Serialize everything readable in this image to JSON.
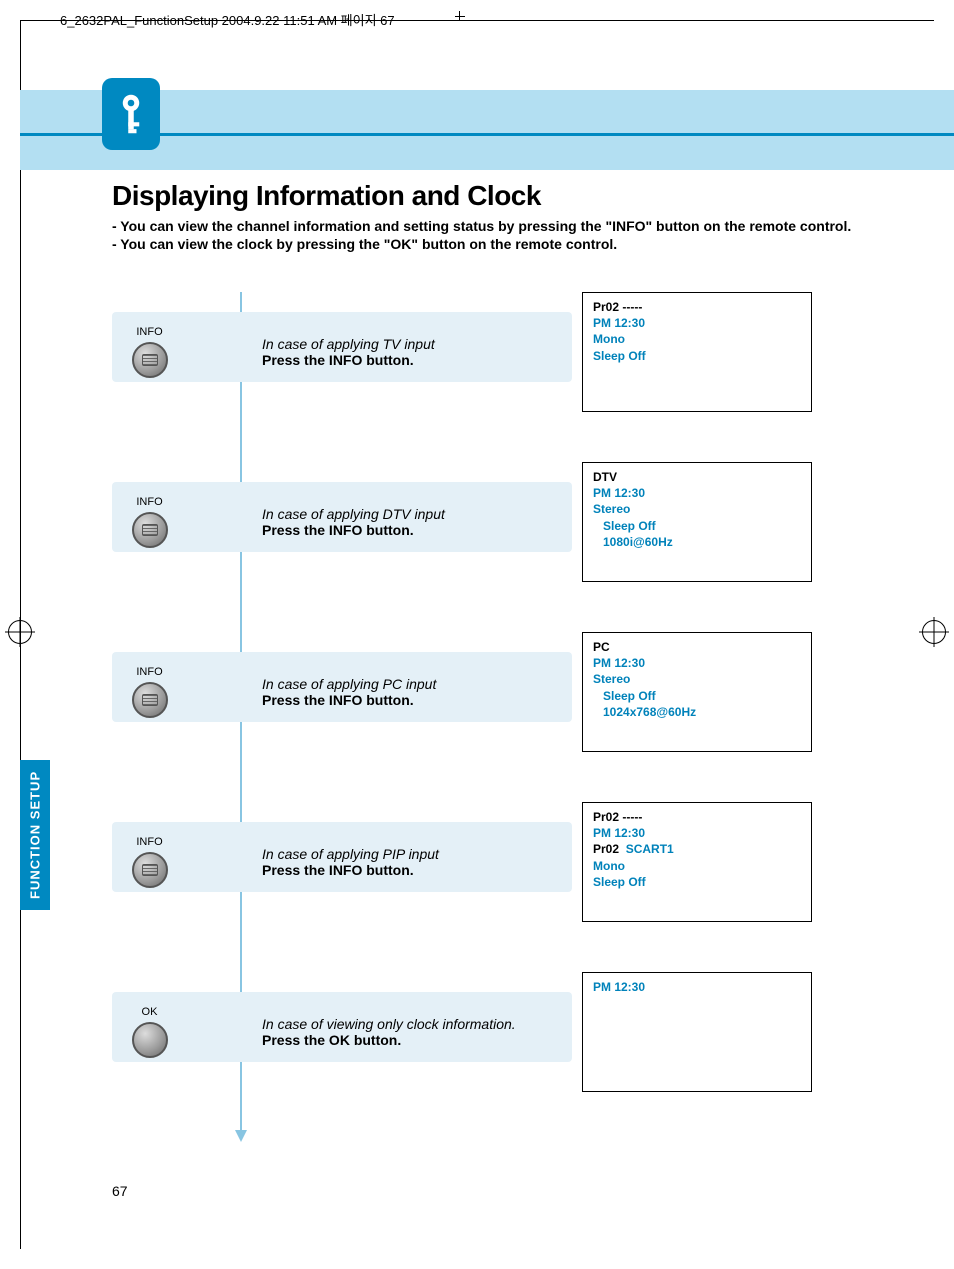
{
  "header_slug": "6_2632PAL_FunctionSetup  2004.9.22  11:51 AM  페이지 67",
  "page_number": "67",
  "side_tab": "FUNCTION SETUP",
  "title": "Displaying Information and Clock",
  "intro1": "- You can view the channel information and setting status by pressing the \"INFO\" button on the remote control.",
  "intro2": "- You can view the clock by pressing the \"OK\" button on the remote control.",
  "steps": [
    {
      "button_label": "INFO",
      "button_kind": "info",
      "case": "In case of applying TV input",
      "action": "Press the INFO button.",
      "result": [
        {
          "text": "Pr02  -----",
          "cls": "black"
        },
        {
          "text": "PM 12:30",
          "cls": "blue"
        },
        {
          "text": "Mono",
          "cls": "blue"
        },
        {
          "text": "Sleep Off",
          "cls": "blue"
        }
      ]
    },
    {
      "button_label": "INFO",
      "button_kind": "info",
      "case": "In case of applying DTV input",
      "action": "Press the INFO button.",
      "result": [
        {
          "text": "DTV",
          "cls": "black"
        },
        {
          "text": "PM 12:30",
          "cls": "blue"
        },
        {
          "text": "Stereo",
          "cls": "blue"
        },
        {
          "text": "Sleep Off",
          "cls": "blue indent"
        },
        {
          "text": "1080i@60Hz",
          "cls": "blue indent"
        }
      ]
    },
    {
      "button_label": "INFO",
      "button_kind": "info",
      "case": "In case of applying PC input",
      "action": "Press the INFO button.",
      "result": [
        {
          "text": "PC",
          "cls": "black"
        },
        {
          "text": "PM 12:30",
          "cls": "blue"
        },
        {
          "text": "Stereo",
          "cls": "blue"
        },
        {
          "text": "Sleep Off",
          "cls": "blue indent"
        },
        {
          "text": "1024x768@60Hz",
          "cls": "blue indent"
        }
      ]
    },
    {
      "button_label": "INFO",
      "button_kind": "info",
      "case": "In case of applying PIP input",
      "action": "Press the INFO button.",
      "result": [
        {
          "text": "Pr02  -----",
          "cls": "black"
        },
        {
          "text": "PM 12:30",
          "cls": "blue"
        },
        {
          "html": "<span class='black'>Pr02&nbsp;&nbsp;</span><span class='blue'>SCART1</span>"
        },
        {
          "text": "Mono",
          "cls": "blue"
        },
        {
          "text": "Sleep Off",
          "cls": "blue"
        }
      ]
    },
    {
      "button_label": "OK",
      "button_kind": "ok",
      "case": "In case of viewing only clock information.",
      "action": "Press the OK button.",
      "result": [
        {
          "text": "PM 12:30",
          "cls": "blue"
        }
      ]
    }
  ]
}
